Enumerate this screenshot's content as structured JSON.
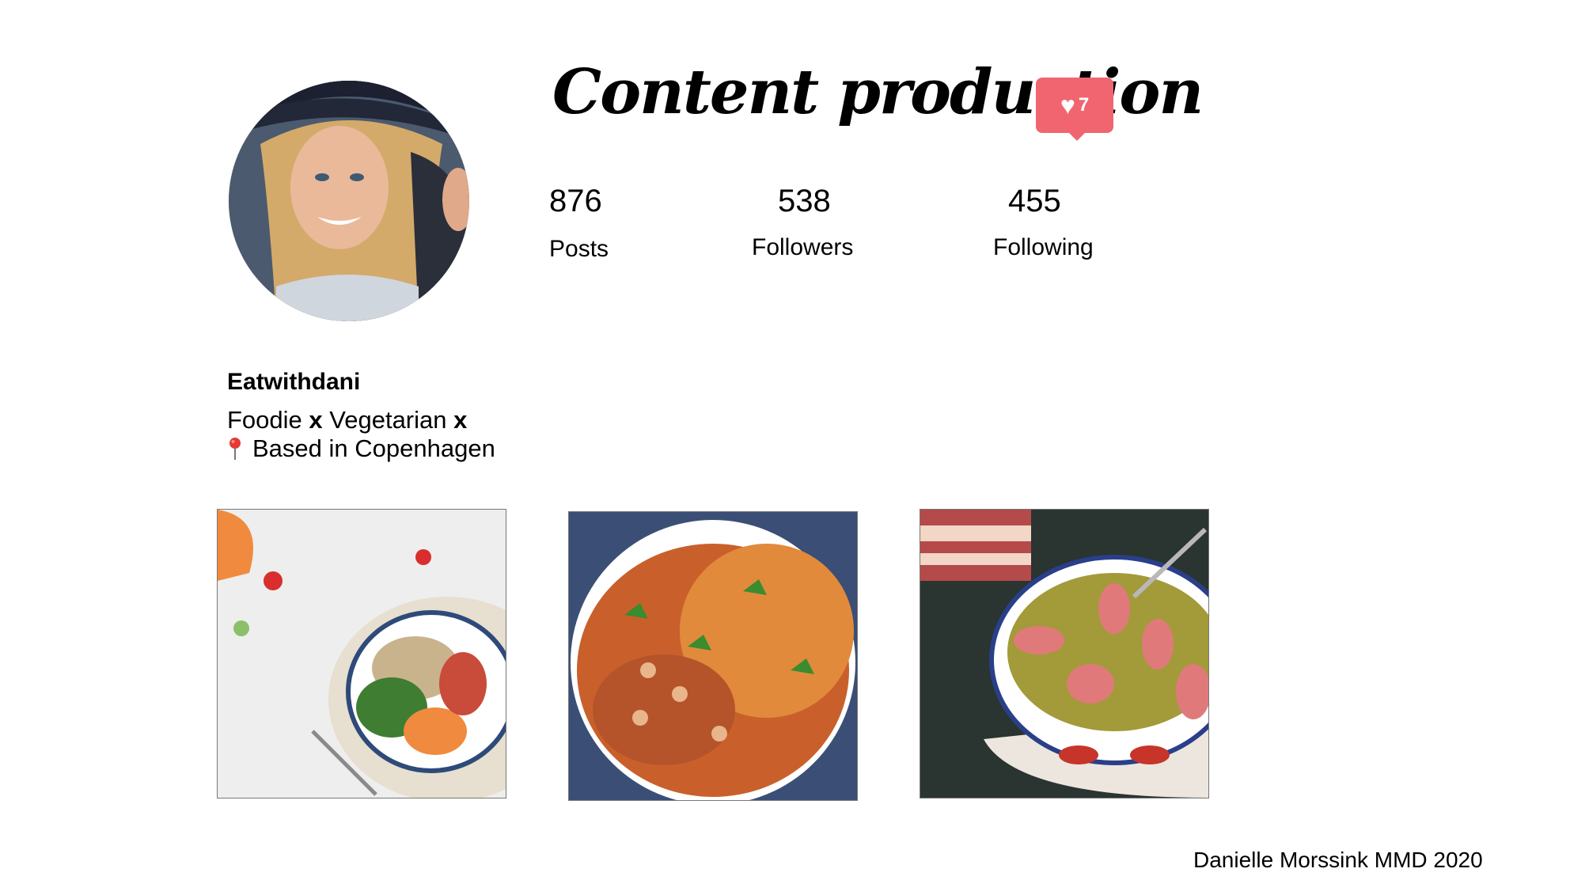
{
  "profile": {
    "title": "Content production",
    "likes_count": "7",
    "username": "Eatwithdani",
    "bio_line1": {
      "part1": "Foodie ",
      "sep1": "x",
      "part2": " Vegetarian ",
      "sep2": "x"
    },
    "bio_line2": "Based in Copenhagen",
    "stats": [
      {
        "value": "876",
        "label": "Posts"
      },
      {
        "value": "538",
        "label": "Followers"
      },
      {
        "value": "455",
        "label": "Following"
      }
    ]
  },
  "icons": {
    "heart": "heart-icon",
    "pin": "location-pin-icon"
  },
  "colors": {
    "like_badge": "#f06570",
    "pin_red": "#e53935"
  },
  "posts": [
    {
      "name": "salad-bowl-photo"
    },
    {
      "name": "bean-stew-photo"
    },
    {
      "name": "pea-soup-photo"
    }
  ],
  "footer": {
    "credit": "Danielle Morssink MMD 2020"
  }
}
